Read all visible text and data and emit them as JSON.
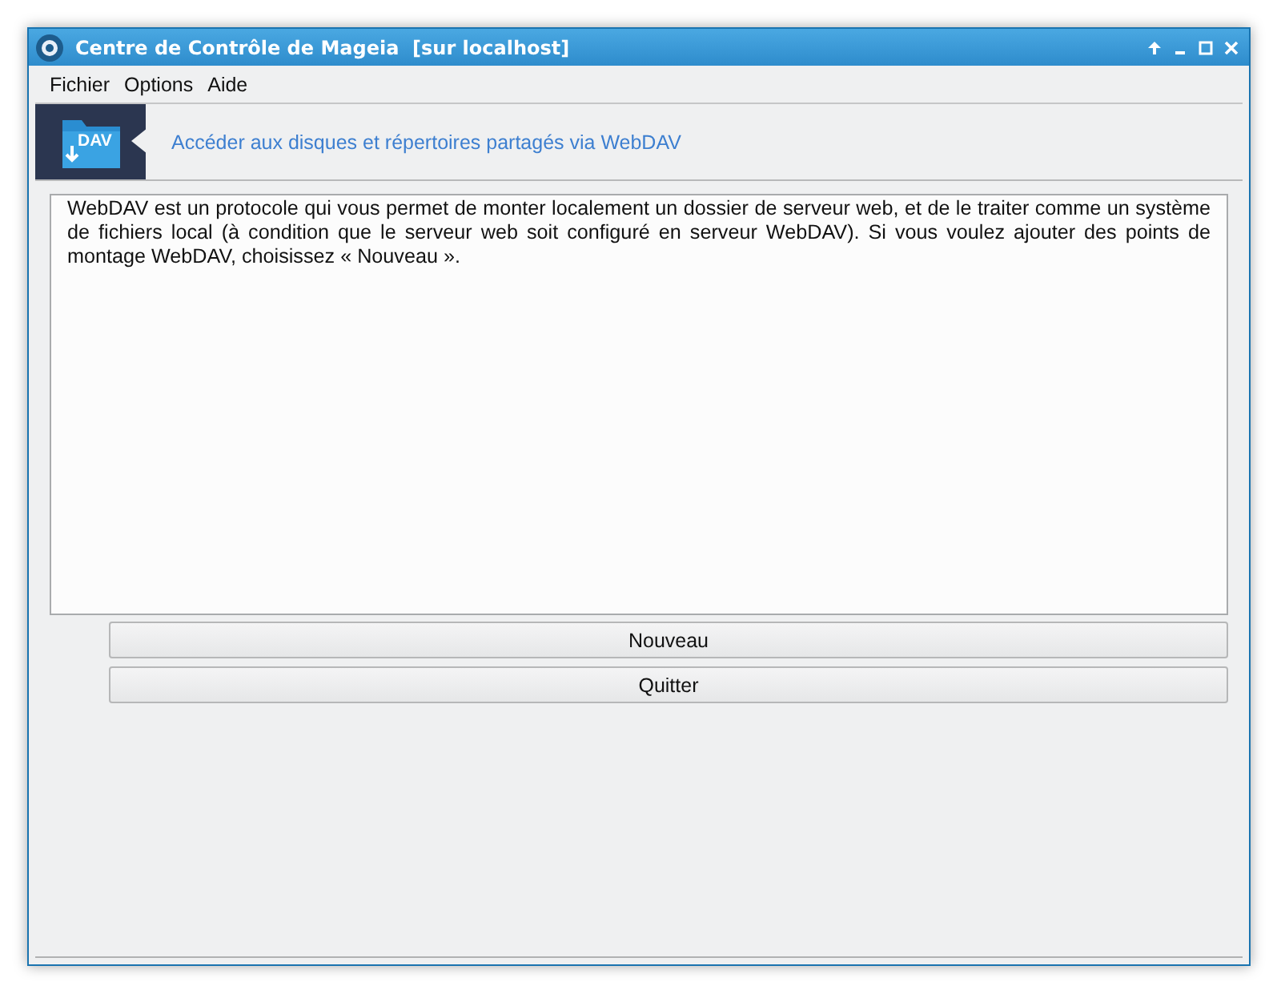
{
  "window": {
    "title": "Centre de Contrôle de Mageia  [sur localhost]"
  },
  "menu": [
    "Fichier",
    "Options",
    "Aide"
  ],
  "header": {
    "icon_label": "DAV",
    "title": "Accéder aux disques et répertoires partagés via WebDAV"
  },
  "description": "WebDAV est un protocole qui vous permet de monter localement un dossier de serveur web, et de le traiter comme un système de fichiers local (à condition que le serveur web soit configuré en serveur WebDAV). Si vous voulez ajouter des points de montage WebDAV, choisissez « Nouveau ».",
  "buttons": [
    "Nouveau",
    "Quitter"
  ]
}
